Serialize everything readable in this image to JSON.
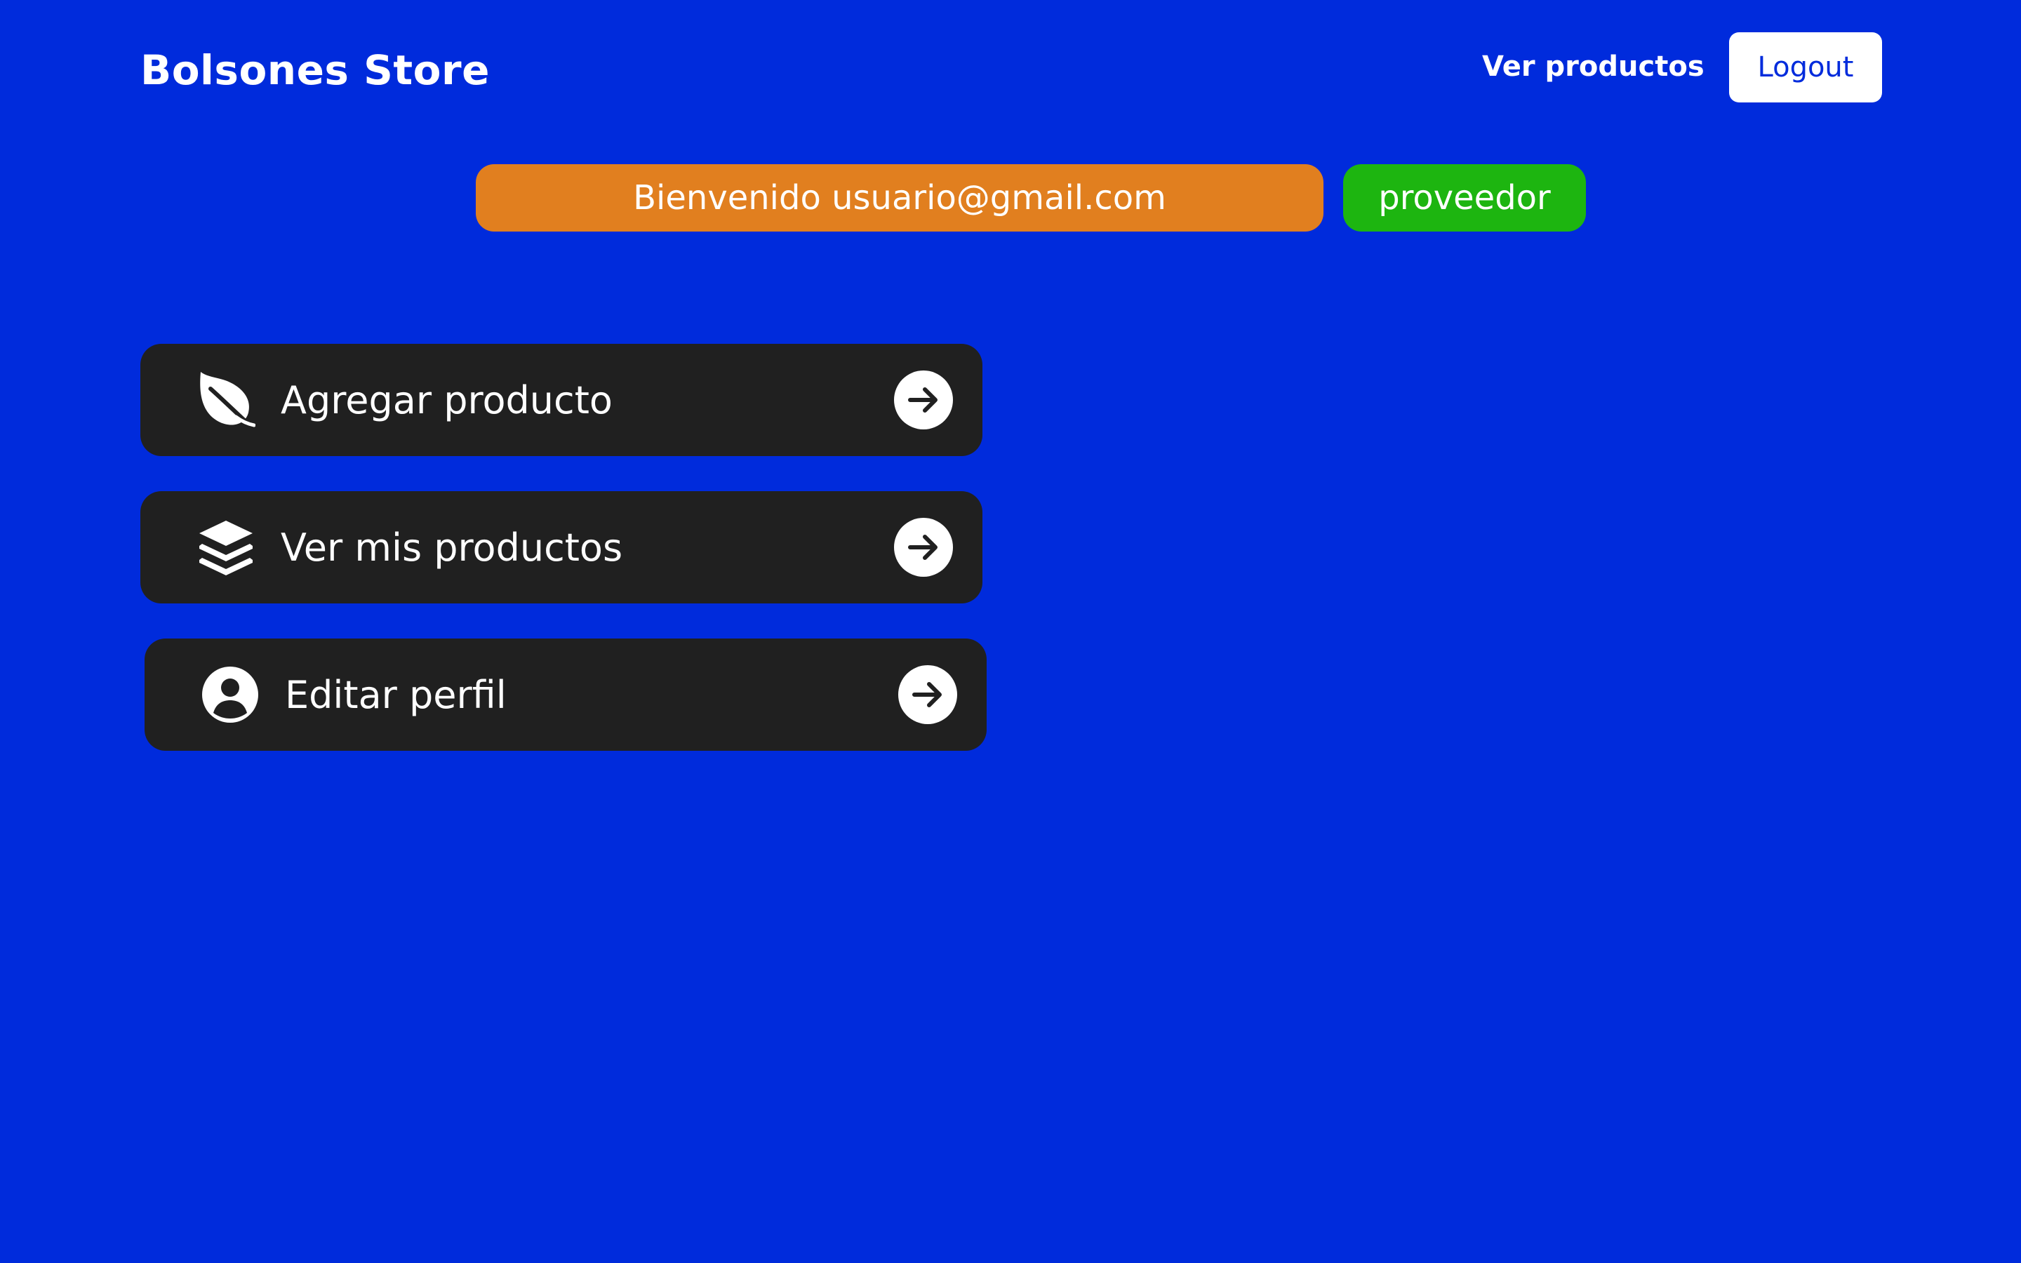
{
  "header": {
    "brand": "Bolsones Store",
    "nav_link": "Ver productos",
    "logout_label": "Logout"
  },
  "welcome": {
    "message": "Bienvenido usuario@gmail.com",
    "role": "proveedor"
  },
  "menu": [
    {
      "label": "Agregar producto",
      "icon": "leaf-icon"
    },
    {
      "label": "Ver mis productos",
      "icon": "layers-icon"
    },
    {
      "label": "Editar perfil",
      "icon": "user-circle-icon"
    }
  ],
  "colors": {
    "background": "#002bdc",
    "card": "#202020",
    "welcome_pill": "#e17f1f",
    "role_pill": "#1db510",
    "logout_bg": "#ffffff",
    "logout_text": "#002bdc"
  }
}
